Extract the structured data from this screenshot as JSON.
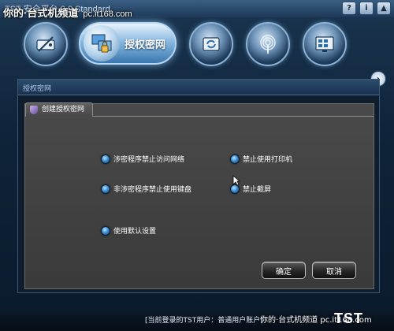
{
  "window": {
    "title": "TST 安全平台 2.0 Standard",
    "watermark_top": "你的·台式机频道",
    "watermark_url": "pc.it168.com",
    "titlebar_buttons": [
      "?",
      "i",
      "▲"
    ]
  },
  "toolbar": {
    "tools": [
      {
        "icon": "drive-icon"
      },
      {
        "icon": "network-lock-icon",
        "label": "授权密网",
        "active": true
      },
      {
        "icon": "sync-icon"
      },
      {
        "icon": "fingerprint-icon"
      },
      {
        "icon": "control-panel-icon"
      }
    ],
    "next_label": "›"
  },
  "content": {
    "section_title": "授权密网",
    "tab_label": "创建授权密网",
    "options": [
      {
        "label": "涉密程序禁止访问网络"
      },
      {
        "label": "禁止使用打印机"
      },
      {
        "label": "非涉密程序禁止使用键盘"
      },
      {
        "label": "禁止截屏"
      },
      {
        "label": "使用默认设置"
      }
    ],
    "buttons": {
      "ok": "确定",
      "cancel": "取消"
    }
  },
  "statusbar": {
    "user_text": "[当前登录的TST用户：普通用户账户]",
    "watermark": "你的·台式机频道 pc.it168.com",
    "logo": "TST"
  },
  "colors": {
    "accent": "#3a78b0",
    "panel_bg": "#404040",
    "frame_bg": "#0f1d2d"
  }
}
